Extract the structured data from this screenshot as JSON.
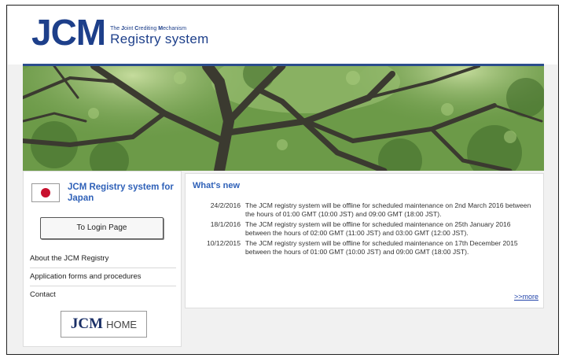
{
  "header": {
    "logo_main": "JCM",
    "logo_sub_prefix": "The ",
    "logo_sub_j": "J",
    "logo_sub_oint": "oint ",
    "logo_sub_c": "C",
    "logo_sub_rediting": "rediting ",
    "logo_sub_m": "M",
    "logo_sub_echanism": "echanism",
    "logo_registry": "Registry system"
  },
  "sidebar": {
    "country_title": "JCM Registry system for Japan",
    "login_label": "To Login Page",
    "nav": [
      {
        "label": "About the JCM Registry"
      },
      {
        "label": "Application forms and procedures"
      },
      {
        "label": "Contact"
      }
    ],
    "home_jcm": "JCM",
    "home_word": "HOME"
  },
  "main": {
    "heading": "What's new",
    "news": [
      {
        "date": "24/2/2016",
        "text": "The JCM registry system will be offline for scheduled maintenance on 2nd March 2016 between the hours of 01:00 GMT (10:00 JST) and 09:00 GMT (18:00 JST)."
      },
      {
        "date": "18/1/2016",
        "text": "The JCM registry system will be offline for scheduled maintenance on 25th January 2016 between the hours of 02:00 GMT (11:00 JST) and 03:00 GMT (12:00 JST)."
      },
      {
        "date": "10/12/2015",
        "text": "The JCM registry system will be offline for scheduled maintenance on 17th December 2015 between the hours of 01:00 GMT (10:00 JST) and 09:00 GMT (18:00 JST)."
      }
    ],
    "more_label": ">>more"
  },
  "colors": {
    "brand_blue": "#1d3f8a",
    "link_blue": "#2f61b8",
    "flag_red": "#c8102e"
  }
}
